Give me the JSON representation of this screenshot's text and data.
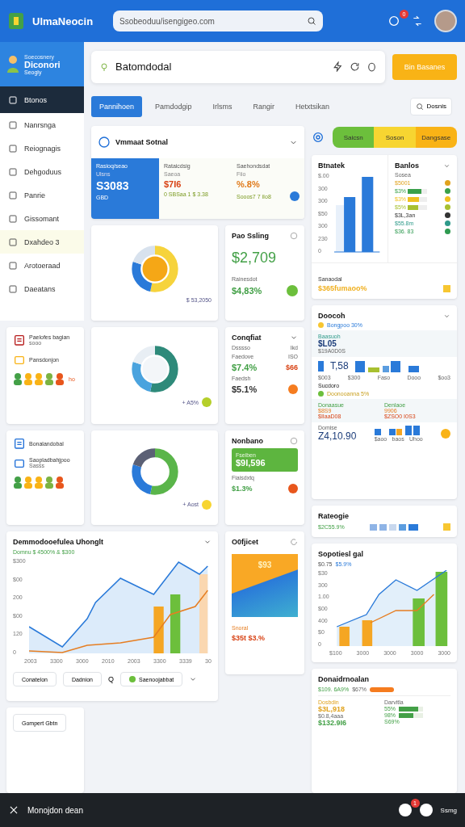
{
  "header": {
    "app_name": "UlmaNeocin",
    "search": {
      "placeholder": "Ssobeoduu/isengigeo.com"
    },
    "notification_badge": "0"
  },
  "sidebar": {
    "profile": {
      "caption": "Soecosnery",
      "name": "Diconori",
      "role": "Seogly"
    },
    "items": [
      {
        "label": "Btonos",
        "selected": true,
        "highlighted": false
      },
      {
        "label": "Nanrsnga",
        "selected": false,
        "highlighted": false
      },
      {
        "label": "Reiognagis",
        "selected": false,
        "highlighted": false
      },
      {
        "label": "Dehgoduus",
        "selected": false,
        "highlighted": false
      },
      {
        "label": "Panrie",
        "selected": false,
        "highlighted": false
      },
      {
        "label": "Gissomant",
        "selected": false,
        "highlighted": false
      },
      {
        "label": "Dxahdeo 3",
        "selected": false,
        "highlighted": true
      },
      {
        "label": "Arotoeraad",
        "selected": false,
        "highlighted": false
      },
      {
        "label": "Daeatans",
        "selected": false,
        "highlighted": false
      }
    ]
  },
  "page": {
    "title": "Batomdodal",
    "action_button": "Bin Basanes"
  },
  "tabs": [
    {
      "label": "Pannihoen",
      "selected": true
    },
    {
      "label": "Pamdodgip",
      "selected": false
    },
    {
      "label": "Irlsms",
      "selected": false
    },
    {
      "label": "Rangir",
      "selected": false
    },
    {
      "label": "Hetxtsikan",
      "selected": false
    }
  ],
  "tab_search_button": "Dosnis",
  "small_cards": [
    {
      "title": "Paelofes bagian",
      "subtitle": "sooo",
      "second": "Pansdonjon",
      "note": "ho"
    },
    {
      "title": "Bonalandobal",
      "second": "Saopladbahjpoo",
      "note": "Sasss"
    }
  ],
  "summary_card": {
    "title": "Vmmaat Sotnal",
    "panels": [
      {
        "label": "Rasioq/seao",
        "sub": "Ulsns",
        "value": "S3083",
        "extra": "GBD"
      },
      {
        "label": "Rataicdsig",
        "sub": "Saeoa",
        "value": "$7I6",
        "extra": "0 SBSaa 1  $ 3.38"
      },
      {
        "label": "Saehondsdat",
        "sub": "Fiio",
        "value": "%.8%",
        "extra": "Sooos7 7 iIo8"
      }
    ]
  },
  "donuts": [
    {
      "caption": "$ 53,2050"
    },
    {
      "caption": "+ A5%"
    },
    {
      "caption": "+ Aost"
    }
  ],
  "pao_card": {
    "title": "Pao Ssling",
    "value": "$2,709",
    "label": "Rainesdot",
    "sub_value": "$4,83%"
  },
  "conq_card": {
    "title": "Conqfiat",
    "sub": "Dsssso",
    "sub_right": "Ikd",
    "rows": [
      {
        "label": "Faedove",
        "right": "ISO",
        "value": "$7.4%",
        "value_right": "$66"
      },
      {
        "label": "Faedsh",
        "value": "$5.1%"
      }
    ]
  },
  "nonb_card": {
    "title": "Nonbano",
    "panel_label": "Fseiben",
    "panel_value": "$9I,596",
    "label": "Fiaisdxtq",
    "value": "$1.3%"
  },
  "line_card": {
    "title": "Demmodooefulea Uhonglt",
    "subtitle": "Domnu $ 4500% & $300",
    "y_labels": [
      "$300",
      "$00",
      "200",
      "$00",
      "120",
      "0"
    ],
    "x_labels": [
      "2003",
      "3300",
      "3000",
      "2010",
      "2003",
      "3300",
      "3339",
      "30"
    ],
    "buttons": [
      "Conatelon",
      "Dadnion"
    ],
    "search_glyph": "Q",
    "select": "Saenoojabbat"
  },
  "image_card": {
    "title": "O0fjicet",
    "image_text": "$93",
    "label": "Snoral",
    "value": "$35t $3.%"
  },
  "bottom_left_button": "Gompert Gbtn",
  "segments": [
    {
      "label": "Saicsn",
      "color": "#6cbf3c"
    },
    {
      "label": "Soson",
      "color": "#f7d531"
    },
    {
      "label": "Dangsase",
      "color": "#f9b316"
    }
  ],
  "bar_card": {
    "title": "Btnatek",
    "y_labels": [
      "$.00",
      "300",
      "300",
      "$50",
      "300",
      "230",
      "0"
    ],
    "list_title": "Banlos",
    "list_sub": "Sosea",
    "rows": [
      {
        "text": "$5001",
        "color": "#e0a21d"
      },
      {
        "text": "$3%",
        "color": "#3aa04a",
        "level": 0.7
      },
      {
        "text": "$3%",
        "color": "#f0c020",
        "level": 0.6
      },
      {
        "text": "$5%",
        "color": "#a8c030",
        "level": 0.55
      },
      {
        "text": "$3L,3an",
        "color": "#333333"
      },
      {
        "text": "$55.8m",
        "color": "#2e9a8a"
      },
      {
        "text": "$36. 83",
        "color": "#2e9a50"
      }
    ],
    "footer_label": "Sanaodal",
    "footer_value": "$365fumaoo%"
  },
  "doocoh_card": {
    "title": "Doocoh",
    "tag": "Bongpoo 30%",
    "block_label": "Baasuoh",
    "block_value": "$L05",
    "block_sub": "$19A0D0S",
    "big_value": "T,58",
    "big_sub": "$003",
    "x_labels": [
      "$300",
      "Faso",
      "Dooo",
      "$oo3"
    ],
    "section_title": "Sucdoro",
    "section_tag": "Doonooanna 5%",
    "columns": [
      {
        "label": "Donaasue",
        "value": "$8S9",
        "sub": "$IIaaD08"
      },
      {
        "label": "Denlaoe",
        "value": "9906",
        "sub": "$ZSO0 I0S3"
      }
    ],
    "bottom_label": "Domise",
    "bottom_value": "Z4,10.90",
    "bottom_x_labels": [
      "$aoo",
      "baos",
      "Uhoo"
    ]
  },
  "rate_card": {
    "title": "Rateogie",
    "value": "$2C55.9%"
  },
  "combo_card": {
    "title": "Sopotiesl gal",
    "values": [
      "$0.75",
      "$5.9%"
    ],
    "y_labels": [
      "$30",
      "300",
      "1.00",
      "$00",
      "400",
      "$0",
      "0"
    ],
    "x_labels": [
      "$100",
      "3000",
      "3000",
      "3000",
      "3000"
    ]
  },
  "domain_card": {
    "title": "Donaidrnoalan",
    "values": [
      "$109. 6A9%",
      "$67%"
    ],
    "left_label": "Dosbdin",
    "left_value": "$3L,918",
    "left_sub": "$0.8,4aaa",
    "left_total": "$132.9I6",
    "right_label": "Darvitla",
    "right_rows": [
      {
        "text": "55%",
        "level": 0.8
      },
      {
        "text": "98%",
        "level": 0.6
      },
      {
        "text": "S69%"
      }
    ]
  },
  "bottom_bar": {
    "title": "Monojdon dean",
    "badge": "1",
    "label": "Ssmg"
  }
}
